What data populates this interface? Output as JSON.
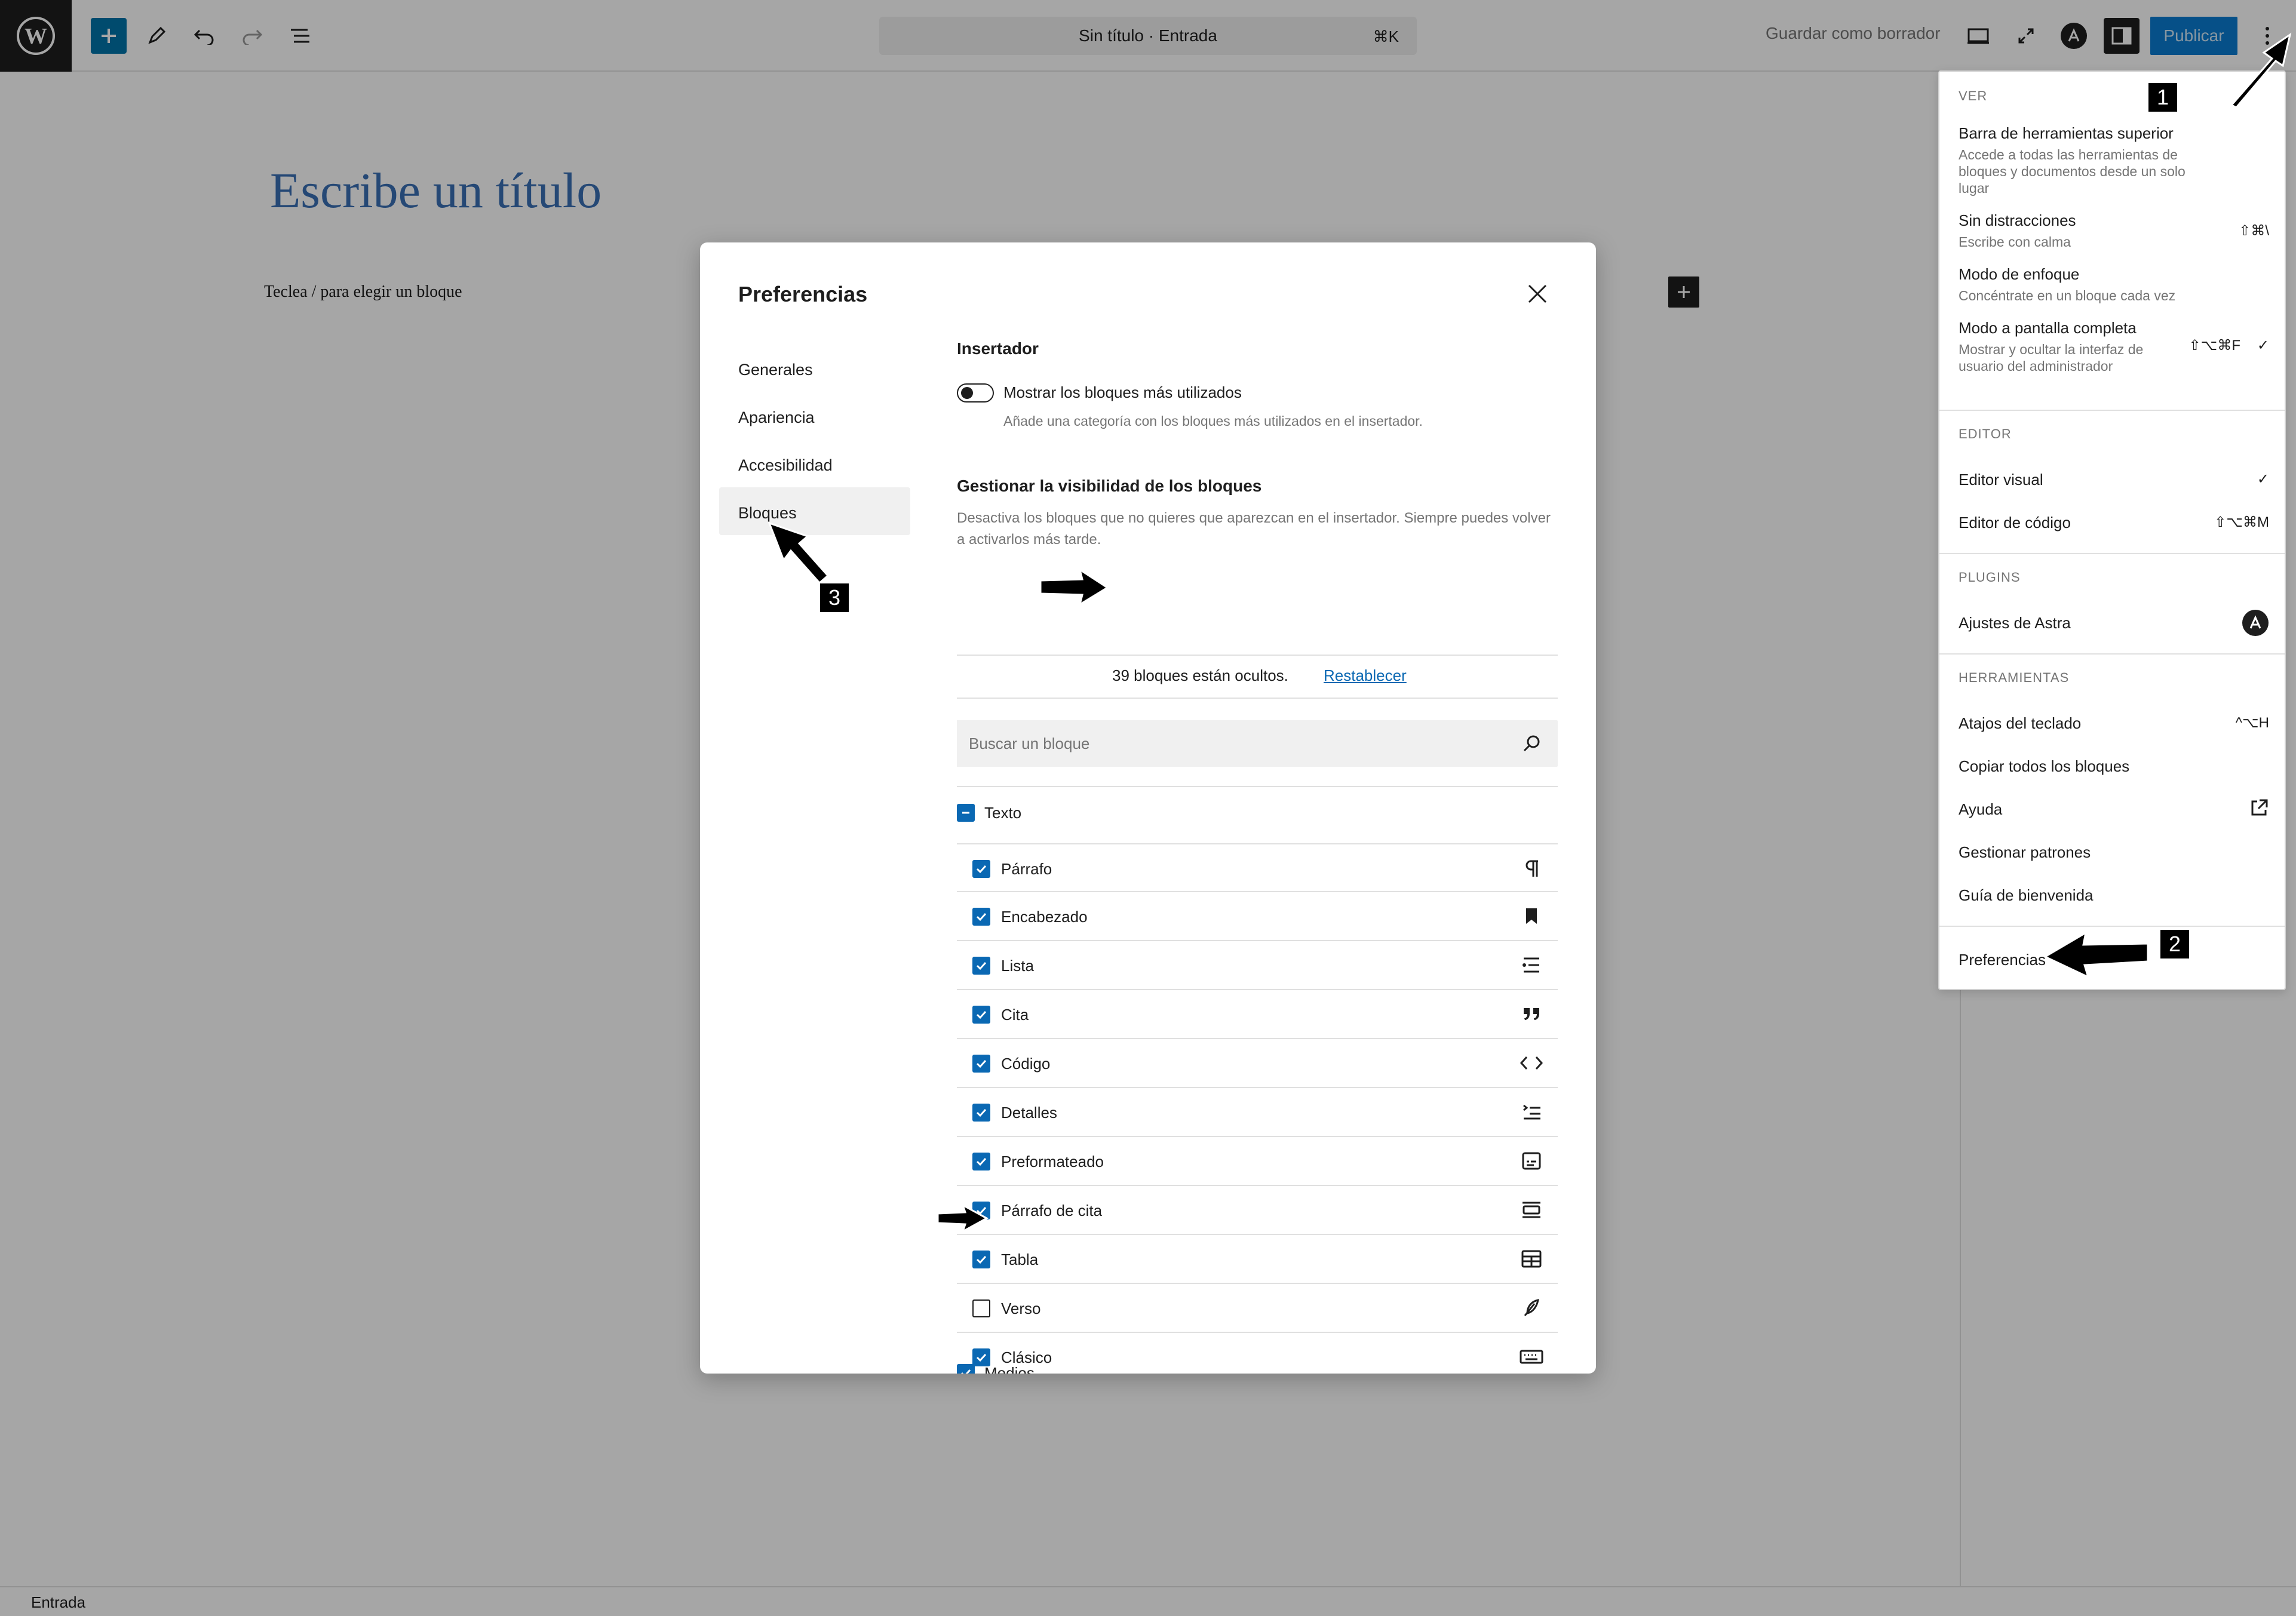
{
  "topbar": {
    "doc_title": "Sin título · Entrada",
    "cmd_shortcut": "⌘K",
    "save_draft": "Guardar como borrador",
    "publish": "Publicar",
    "icons": [
      "wordpress-icon",
      "plus-icon",
      "pen-icon",
      "undo-icon",
      "redo-icon",
      "list-view-icon",
      "desktop-icon",
      "fullscreen-icon",
      "astra-icon",
      "sidebar-icon",
      "more-vertical-icon"
    ]
  },
  "editor": {
    "title_placeholder": "Escribe un título",
    "block_hint": "Teclea / para elegir un bloque"
  },
  "statusbar": {
    "label": "Entrada"
  },
  "menu": {
    "ver": {
      "heading": "VER",
      "items": [
        {
          "label": "Barra de herramientas superior",
          "desc": "Accede a todas las herramientas de bloques y documentos desde un solo lugar",
          "shortcut": ""
        },
        {
          "label": "Sin distracciones",
          "desc": "Escribe con calma",
          "shortcut": "⇧⌘\\"
        },
        {
          "label": "Modo de enfoque",
          "desc": "Concéntrate en un bloque cada vez",
          "shortcut": ""
        },
        {
          "label": "Modo a pantalla completa",
          "desc": "Mostrar y ocultar la interfaz de usuario del administrador",
          "shortcut": "⇧⌥⌘F",
          "check": "✓"
        }
      ]
    },
    "editor": {
      "heading": "EDITOR",
      "items": [
        {
          "label": "Editor visual",
          "shortcut": "✓"
        },
        {
          "label": "Editor de código",
          "shortcut": "⇧⌥⌘M"
        }
      ]
    },
    "plugins": {
      "heading": "PLUGINS",
      "items": [
        {
          "label": "Ajustes de Astra"
        }
      ]
    },
    "herramientas": {
      "heading": "HERRAMIENTAS",
      "items": [
        {
          "label": "Atajos del teclado",
          "shortcut": "^⌥H"
        },
        {
          "label": "Copiar todos los bloques"
        },
        {
          "label": "Ayuda"
        },
        {
          "label": "Gestionar patrones"
        },
        {
          "label": "Guía de bienvenida"
        }
      ]
    },
    "preferences": "Preferencias"
  },
  "modal": {
    "title": "Preferencias",
    "nav": [
      "Generales",
      "Apariencia",
      "Accesibilidad",
      "Bloques"
    ],
    "active_nav": "Bloques",
    "inserter": {
      "heading": "Insertador",
      "toggle_label": "Mostrar los bloques más utilizados",
      "toggle_help": "Añade una categoría con los bloques más utilizados en el insertador.",
      "toggle_on": false
    },
    "visibility": {
      "heading": "Gestionar la visibilidad de los bloques",
      "help": "Desactiva los bloques que no quieres que aparezcan en el insertador. Siempre puedes volver a activarlos más tarde.",
      "hidden_count_text": "39 bloques están ocultos.",
      "reset": "Restablecer",
      "search_placeholder": "Buscar un bloque"
    },
    "categories": [
      {
        "name": "Texto",
        "state": "partial",
        "blocks": [
          {
            "label": "Párrafo",
            "checked": true,
            "icon": "paragraph-icon"
          },
          {
            "label": "Encabezado",
            "checked": true,
            "icon": "bookmark-icon"
          },
          {
            "label": "Lista",
            "checked": true,
            "icon": "list-icon"
          },
          {
            "label": "Cita",
            "checked": true,
            "icon": "quote-icon"
          },
          {
            "label": "Código",
            "checked": true,
            "icon": "code-icon"
          },
          {
            "label": "Detalles",
            "checked": true,
            "icon": "details-icon"
          },
          {
            "label": "Preformateado",
            "checked": true,
            "icon": "preformatted-icon"
          },
          {
            "label": "Párrafo de cita",
            "checked": true,
            "icon": "pullquote-icon"
          },
          {
            "label": "Tabla",
            "checked": true,
            "icon": "table-icon"
          },
          {
            "label": "Verso",
            "checked": false,
            "icon": "feather-icon"
          },
          {
            "label": "Clásico",
            "checked": true,
            "icon": "keyboard-icon"
          }
        ]
      },
      {
        "name": "Medios",
        "state": "checked",
        "blocks": []
      }
    ]
  },
  "callouts": [
    "1",
    "2",
    "3"
  ]
}
